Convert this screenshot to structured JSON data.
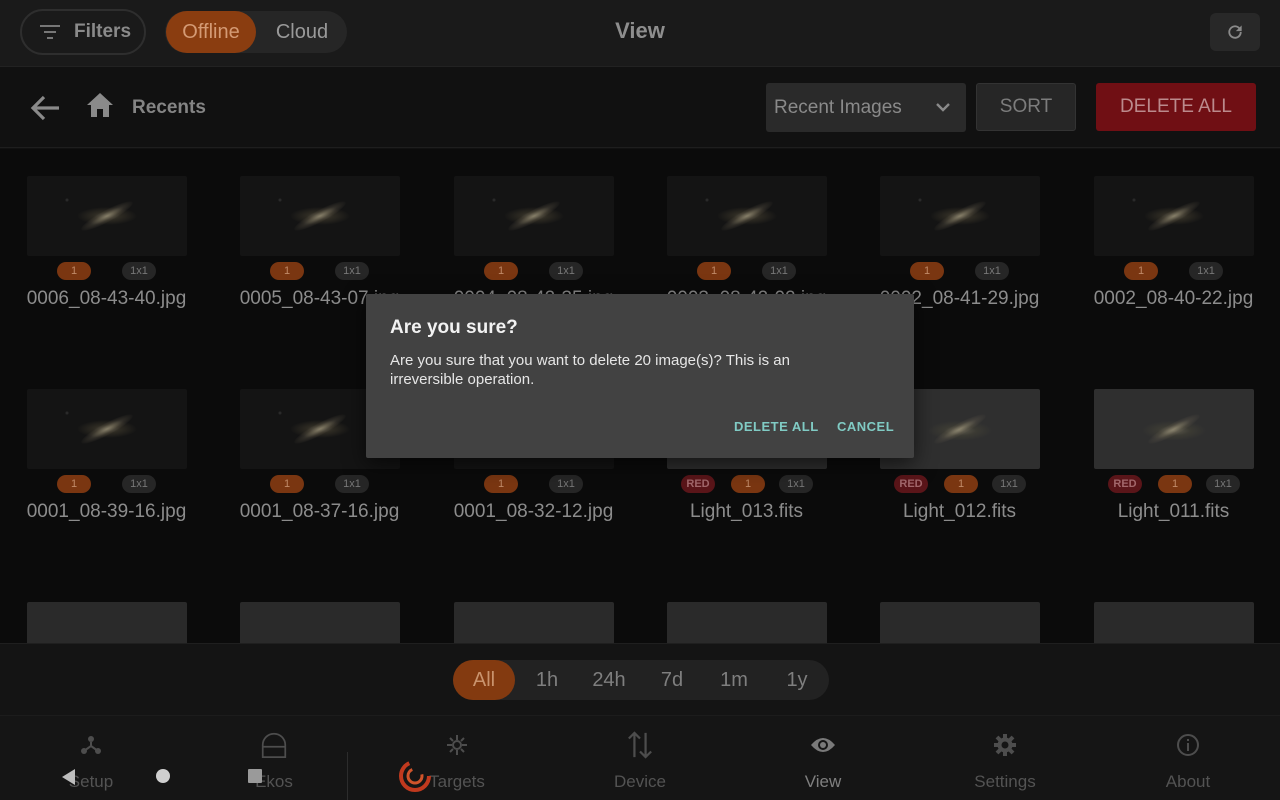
{
  "header": {
    "filters_label": "Filters",
    "storage_tabs": [
      "Offline",
      "Cloud"
    ],
    "title": "View"
  },
  "navrow": {
    "breadcrumb": "Recents",
    "select_value": "Recent Images",
    "sort_label": "SORT",
    "delete_all_label": "DELETE ALL"
  },
  "grid": {
    "items": [
      {
        "name": "0006_08-43-40.jpg",
        "count": "1",
        "binning": "1x1"
      },
      {
        "name": "0005_08-43-07.jpg",
        "count": "1",
        "binning": "1x1"
      },
      {
        "name": "0004_08-42-35.jpg",
        "count": "1",
        "binning": "1x1"
      },
      {
        "name": "0003_08-42-02.jpg",
        "count": "1",
        "binning": "1x1"
      },
      {
        "name": "0002_08-41-29.jpg",
        "count": "1",
        "binning": "1x1"
      },
      {
        "name": "0002_08-40-22.jpg",
        "count": "1",
        "binning": "1x1"
      },
      {
        "name": "0001_08-39-16.jpg",
        "count": "1",
        "binning": "1x1"
      },
      {
        "name": "0001_08-37-16.jpg",
        "count": "1",
        "binning": "1x1"
      },
      {
        "name": "0001_08-32-12.jpg",
        "count": "1",
        "binning": "1x1"
      },
      {
        "name": "Light_013.fits",
        "filter": "RED",
        "count": "1",
        "binning": "1x1"
      },
      {
        "name": "Light_012.fits",
        "filter": "RED",
        "count": "1",
        "binning": "1x1"
      },
      {
        "name": "Light_011.fits",
        "filter": "RED",
        "count": "1",
        "binning": "1x1"
      }
    ]
  },
  "time_filters": [
    "All",
    "1h",
    "24h",
    "7d",
    "1m",
    "1y"
  ],
  "bottom_nav": [
    "Setup",
    "Ekos",
    "Targets",
    "Device",
    "View",
    "Settings",
    "About"
  ],
  "dialog": {
    "title": "Are you sure?",
    "message": "Are you sure that you want to delete 20 image(s)? This is an irreversible operation.",
    "confirm_label": "DELETE ALL",
    "cancel_label": "CANCEL"
  },
  "colors": {
    "accent_orange": "#8a3d10",
    "danger_red": "#700f14",
    "dialog_button": "#80cbc4"
  }
}
